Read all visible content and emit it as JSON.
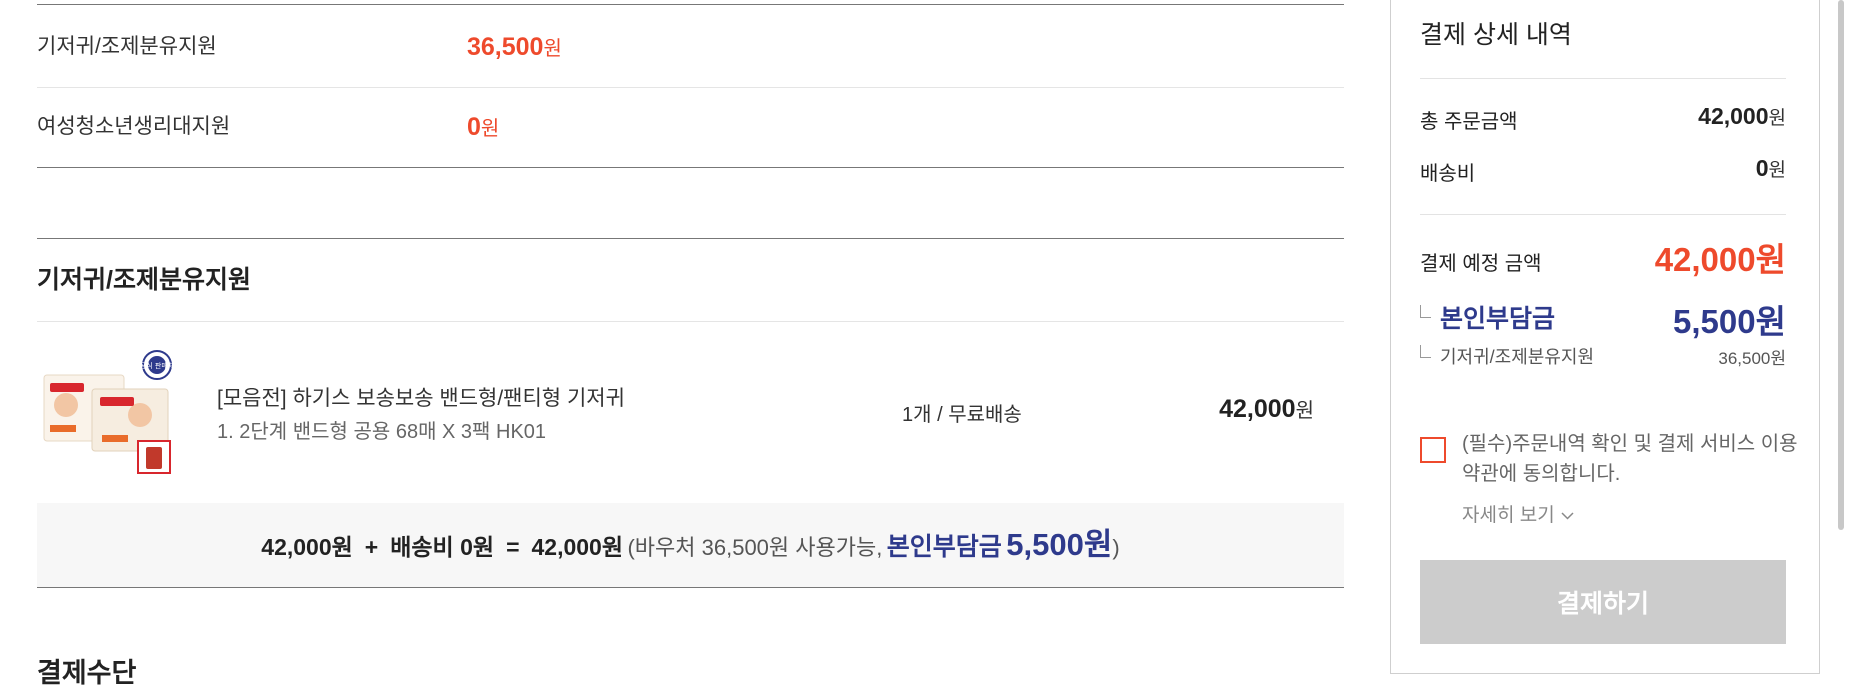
{
  "support_rows": [
    {
      "label": "기저귀/조제분유지원",
      "amount": "36,500",
      "unit": "원"
    },
    {
      "label": "여성청소년생리대지원",
      "amount": "0",
      "unit": "원"
    }
  ],
  "section_title": "기저귀/조제분유지원",
  "product": {
    "thumb_badge": "공식 판매처",
    "name": "[모음전] 하기스 보송보송 밴드형/팬티형 기저귀",
    "option": "1. 2단계 밴드형 공용 68매 X 3팩 HK01",
    "qty_shipping": "1개 / 무료배송",
    "price": "42,000",
    "price_unit": "원"
  },
  "summary": {
    "subtotal": "42,000원",
    "plus": "+",
    "shipping": "배송비 0원",
    "equals": "=",
    "total": "42,000원",
    "voucher_note": "(바우처 36,500원 사용가능,",
    "self_pay_label": "본인부담금",
    "self_pay_amount": "5,500원",
    "close_paren": ")"
  },
  "next_section_heading": "결제수단",
  "panel": {
    "title": "결제 상세 내역",
    "order_total_label": "총 주문금액",
    "order_total_value": "42,000",
    "shipping_label": "배송비",
    "shipping_value": "0",
    "won": "원",
    "expected_label": "결제 예정 금액",
    "expected_value": "42,000",
    "self_pay_label": "본인부담금",
    "self_pay_value": "5,500",
    "support_label": "기저귀/조제분유지원",
    "support_value": "36,500원",
    "agree_text": "(필수)주문내역 확인 및 결제 서비스 이용약관에 동의합니다.",
    "agree_checked": false,
    "detail_link": "자세히 보기",
    "pay_button": "결제하기"
  },
  "colors": {
    "accent_red": "#ee4a2c",
    "accent_navy": "#2e3a8c",
    "button_disabled": "#cccccc"
  }
}
